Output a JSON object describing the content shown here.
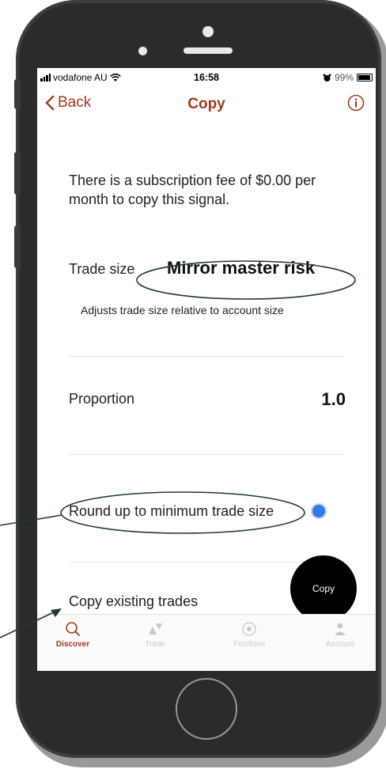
{
  "status_bar": {
    "carrier": "vodafone AU",
    "time": "16:58",
    "battery": "99%"
  },
  "nav": {
    "back_label": "Back",
    "title": "Copy"
  },
  "content": {
    "fee_text": "There is a subscription fee of $0.00 per month to copy this signal.",
    "trade_size": {
      "label": "Trade size",
      "value": "Mirror master risk",
      "description": "Adjusts trade size relative to account size"
    },
    "proportion": {
      "label": "Proportion",
      "value": "1.0"
    },
    "round_up": {
      "label": "Round up to minimum trade size",
      "enabled": true
    },
    "copy_existing": {
      "label": "Copy existing trades"
    },
    "copy_button_label": "Copy"
  },
  "tabs": [
    {
      "label": "Discover",
      "icon": "search-icon",
      "active": true
    },
    {
      "label": "Trade",
      "icon": "trade-icon",
      "active": false
    },
    {
      "label": "Positions",
      "icon": "positions-icon",
      "active": false
    },
    {
      "label": "Account",
      "icon": "account-icon",
      "active": false
    }
  ],
  "colors": {
    "accent": "#a13a1b",
    "toggle": "#2f7be5",
    "annotation": "#1e3a3a"
  }
}
